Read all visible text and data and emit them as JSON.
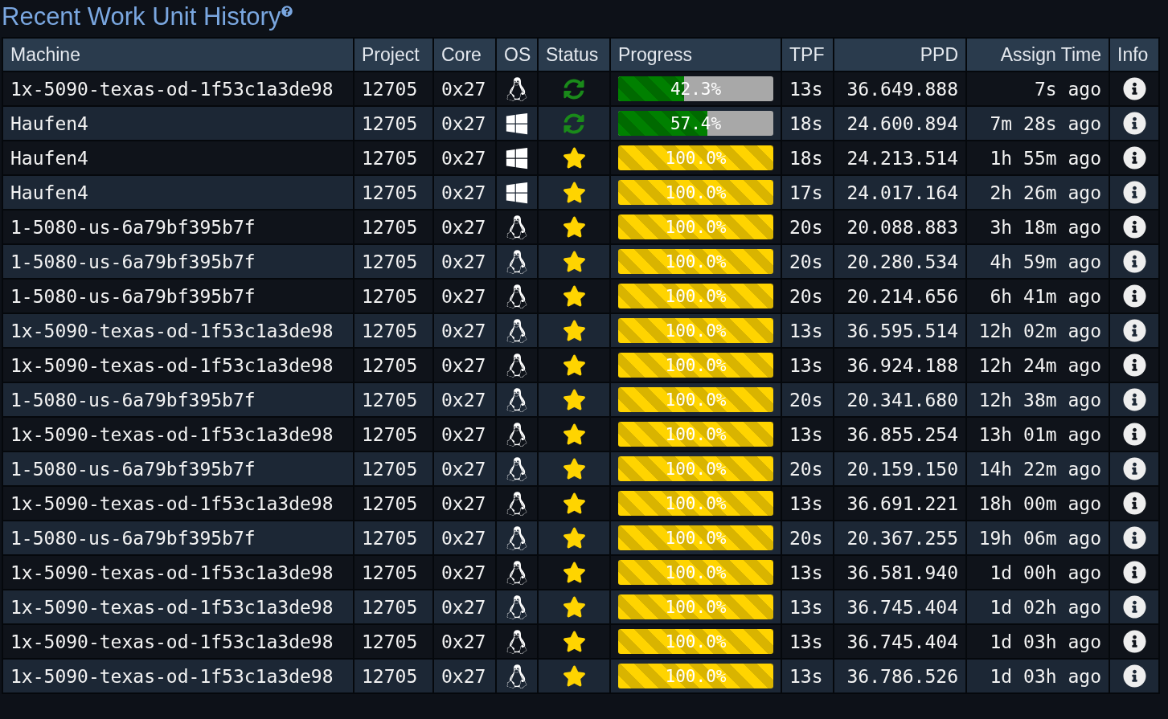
{
  "title": "Recent Work Unit History",
  "columns": [
    "Machine",
    "Project",
    "Core",
    "OS",
    "Status",
    "Progress",
    "TPF",
    "PPD",
    "Assign Time",
    "Info"
  ],
  "rows": [
    {
      "machine": "1x-5090-texas-od-1f53c1a3de98",
      "project": "12705",
      "core": "0x27",
      "os": {
        "kind": "linux"
      },
      "status": {
        "kind": "running"
      },
      "level": 0.423,
      "progress": "42.3%",
      "tpf": "13s",
      "ppd": "36.649.888",
      "assigned": "7s ago"
    },
    {
      "machine": "Haufen4",
      "project": "12705",
      "core": "0x27",
      "os": {
        "kind": "windows"
      },
      "status": {
        "kind": "running"
      },
      "level": 0.574,
      "progress": "57.4%",
      "tpf": "18s",
      "ppd": "24.600.894",
      "assigned": "7m 28s ago"
    },
    {
      "machine": "Haufen4",
      "project": "12705",
      "core": "0x27",
      "os": {
        "kind": "windows"
      },
      "status": {
        "kind": "done"
      },
      "level": 1,
      "progress": "100.0%",
      "tpf": "18s",
      "ppd": "24.213.514",
      "assigned": "1h 55m ago"
    },
    {
      "machine": "Haufen4",
      "project": "12705",
      "core": "0x27",
      "os": {
        "kind": "windows"
      },
      "status": {
        "kind": "done"
      },
      "level": 1,
      "progress": "100.0%",
      "tpf": "17s",
      "ppd": "24.017.164",
      "assigned": "2h 26m ago"
    },
    {
      "machine": "1-5080-us-6a79bf395b7f",
      "project": "12705",
      "core": "0x27",
      "os": {
        "kind": "linux"
      },
      "status": {
        "kind": "done"
      },
      "level": 1,
      "progress": "100.0%",
      "tpf": "20s",
      "ppd": "20.088.883",
      "assigned": "3h 18m ago"
    },
    {
      "machine": "1-5080-us-6a79bf395b7f",
      "project": "12705",
      "core": "0x27",
      "os": {
        "kind": "linux"
      },
      "status": {
        "kind": "done"
      },
      "level": 1,
      "progress": "100.0%",
      "tpf": "20s",
      "ppd": "20.280.534",
      "assigned": "4h 59m ago"
    },
    {
      "machine": "1-5080-us-6a79bf395b7f",
      "project": "12705",
      "core": "0x27",
      "os": {
        "kind": "linux"
      },
      "status": {
        "kind": "done"
      },
      "level": 1,
      "progress": "100.0%",
      "tpf": "20s",
      "ppd": "20.214.656",
      "assigned": "6h 41m ago"
    },
    {
      "machine": "1x-5090-texas-od-1f53c1a3de98",
      "project": "12705",
      "core": "0x27",
      "os": {
        "kind": "linux"
      },
      "status": {
        "kind": "done"
      },
      "level": 1,
      "progress": "100.0%",
      "tpf": "13s",
      "ppd": "36.595.514",
      "assigned": "12h 02m ago"
    },
    {
      "machine": "1x-5090-texas-od-1f53c1a3de98",
      "project": "12705",
      "core": "0x27",
      "os": {
        "kind": "linux"
      },
      "status": {
        "kind": "done"
      },
      "level": 1,
      "progress": "100.0%",
      "tpf": "13s",
      "ppd": "36.924.188",
      "assigned": "12h 24m ago"
    },
    {
      "machine": "1-5080-us-6a79bf395b7f",
      "project": "12705",
      "core": "0x27",
      "os": {
        "kind": "linux"
      },
      "status": {
        "kind": "done"
      },
      "level": 1,
      "progress": "100.0%",
      "tpf": "20s",
      "ppd": "20.341.680",
      "assigned": "12h 38m ago"
    },
    {
      "machine": "1x-5090-texas-od-1f53c1a3de98",
      "project": "12705",
      "core": "0x27",
      "os": {
        "kind": "linux"
      },
      "status": {
        "kind": "done"
      },
      "level": 1,
      "progress": "100.0%",
      "tpf": "13s",
      "ppd": "36.855.254",
      "assigned": "13h 01m ago"
    },
    {
      "machine": "1-5080-us-6a79bf395b7f",
      "project": "12705",
      "core": "0x27",
      "os": {
        "kind": "linux"
      },
      "status": {
        "kind": "done"
      },
      "level": 1,
      "progress": "100.0%",
      "tpf": "20s",
      "ppd": "20.159.150",
      "assigned": "14h 22m ago"
    },
    {
      "machine": "1x-5090-texas-od-1f53c1a3de98",
      "project": "12705",
      "core": "0x27",
      "os": {
        "kind": "linux"
      },
      "status": {
        "kind": "done"
      },
      "level": 1,
      "progress": "100.0%",
      "tpf": "13s",
      "ppd": "36.691.221",
      "assigned": "18h 00m ago"
    },
    {
      "machine": "1-5080-us-6a79bf395b7f",
      "project": "12705",
      "core": "0x27",
      "os": {
        "kind": "linux"
      },
      "status": {
        "kind": "done"
      },
      "level": 1,
      "progress": "100.0%",
      "tpf": "20s",
      "ppd": "20.367.255",
      "assigned": "19h 06m ago"
    },
    {
      "machine": "1x-5090-texas-od-1f53c1a3de98",
      "project": "12705",
      "core": "0x27",
      "os": {
        "kind": "linux"
      },
      "status": {
        "kind": "done"
      },
      "level": 1,
      "progress": "100.0%",
      "tpf": "13s",
      "ppd": "36.581.940",
      "assigned": "1d 00h ago"
    },
    {
      "machine": "1x-5090-texas-od-1f53c1a3de98",
      "project": "12705",
      "core": "0x27",
      "os": {
        "kind": "linux"
      },
      "status": {
        "kind": "done"
      },
      "level": 1,
      "progress": "100.0%",
      "tpf": "13s",
      "ppd": "36.745.404",
      "assigned": "1d 02h ago"
    },
    {
      "machine": "1x-5090-texas-od-1f53c1a3de98",
      "project": "12705",
      "core": "0x27",
      "os": {
        "kind": "linux"
      },
      "status": {
        "kind": "done"
      },
      "level": 1,
      "progress": "100.0%",
      "tpf": "13s",
      "ppd": "36.745.404",
      "assigned": "1d 03h ago"
    },
    {
      "machine": "1x-5090-texas-od-1f53c1a3de98",
      "project": "12705",
      "core": "0x27",
      "os": {
        "kind": "linux"
      },
      "status": {
        "kind": "done"
      },
      "level": 1,
      "progress": "100.0%",
      "tpf": "13s",
      "ppd": "36.786.526",
      "assigned": "1d 03h ago"
    }
  ]
}
